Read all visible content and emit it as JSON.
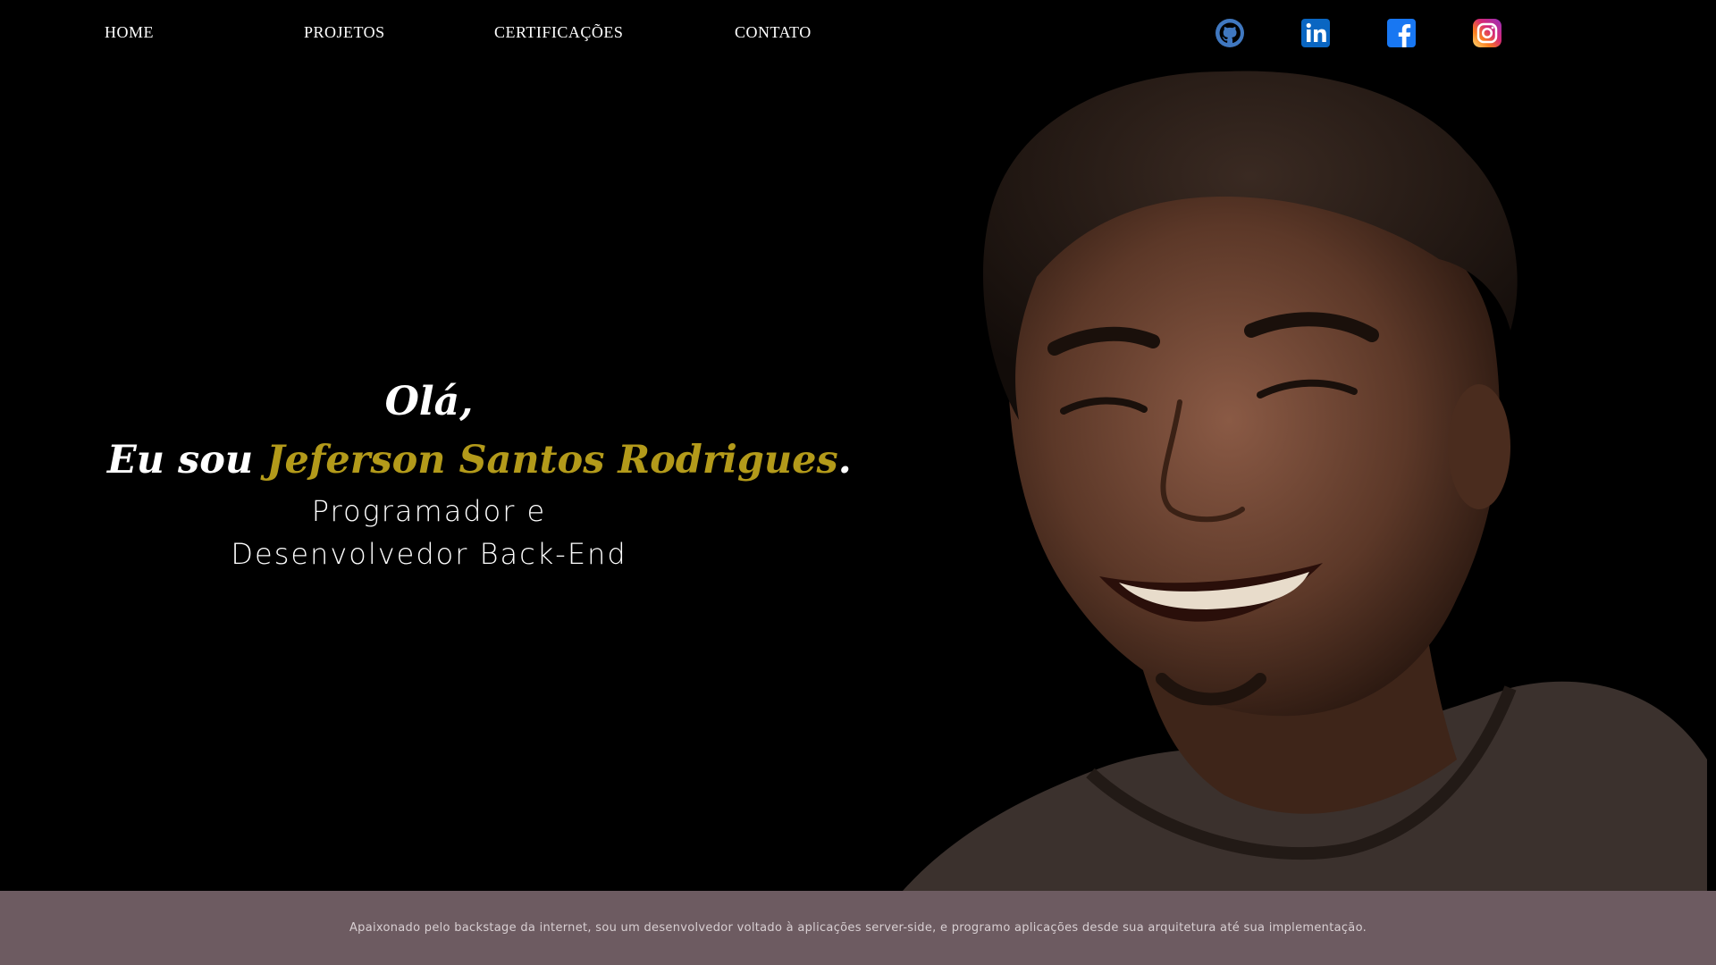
{
  "nav": {
    "items": [
      {
        "label": "HOME",
        "icon": null
      },
      {
        "label": "PROJETOS",
        "icon": null
      },
      {
        "label": "CERTIFICAÇÕES",
        "icon": null
      },
      {
        "label": "CONTATO",
        "icon": null
      }
    ],
    "social": [
      {
        "icon": "github-icon",
        "color": "#4078c0"
      },
      {
        "icon": "linkedin-icon",
        "color": "#0a66c2"
      },
      {
        "icon": "facebook-icon",
        "color": "#1877f2"
      },
      {
        "icon": "instagram-icon",
        "color": "#e1306c"
      }
    ]
  },
  "hero": {
    "greeting": "Olá,",
    "intro_prefix": "Eu sou ",
    "name": "Jeferson Santos Rodrigues",
    "intro_suffix": ".",
    "role_line1": "Programador e",
    "role_line2": "Desenvolvedor Back-End",
    "name_color": "#b39a1a"
  },
  "footer": {
    "text": "Apaixonado pelo backstage da internet, sou um desenvolvedor voltado à aplicações server-side, e programo aplicações desde sua arquitetura até sua implementação.",
    "background": "#6d5b61"
  }
}
